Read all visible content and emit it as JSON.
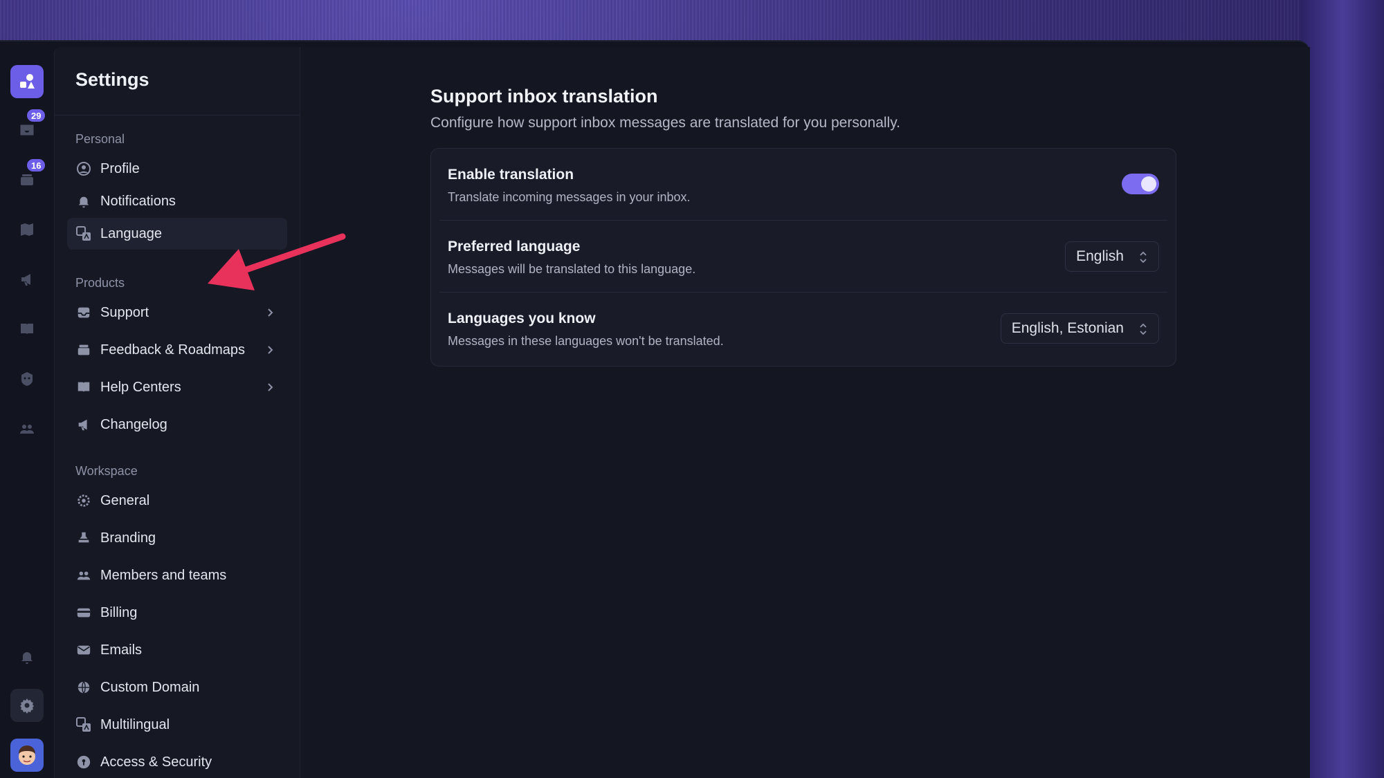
{
  "rail": {
    "items": [
      {
        "icon": "inbox-icon",
        "badge": "29"
      },
      {
        "icon": "archive-icon",
        "badge": "16"
      },
      {
        "icon": "map-icon"
      },
      {
        "icon": "megaphone-icon"
      },
      {
        "icon": "book-icon"
      },
      {
        "icon": "bot-icon"
      },
      {
        "icon": "team-icon"
      }
    ],
    "bottom": [
      {
        "icon": "bell-icon"
      },
      {
        "icon": "gear-icon"
      },
      {
        "icon": "avatar"
      }
    ]
  },
  "sidebar": {
    "title": "Settings",
    "personal_label": "Personal",
    "personal": [
      {
        "label": "Profile",
        "icon": "user-circle-icon"
      },
      {
        "label": "Notifications",
        "icon": "bell-icon"
      },
      {
        "label": "Language",
        "icon": "translate-icon",
        "active": true
      }
    ],
    "products_label": "Products",
    "products": [
      {
        "label": "Support",
        "icon": "inbox-icon"
      },
      {
        "label": "Feedback & Roadmaps",
        "icon": "archive-icon"
      },
      {
        "label": "Help Centers",
        "icon": "book-icon"
      },
      {
        "label": "Changelog",
        "icon": "megaphone-icon"
      }
    ],
    "workspace_label": "Workspace",
    "workspace": [
      {
        "label": "General",
        "icon": "gear-icon"
      },
      {
        "label": "Branding",
        "icon": "stamp-icon"
      },
      {
        "label": "Members and teams",
        "icon": "team-icon"
      },
      {
        "label": "Billing",
        "icon": "card-icon"
      },
      {
        "label": "Emails",
        "icon": "mail-icon"
      },
      {
        "label": "Custom Domain",
        "icon": "globe-icon"
      },
      {
        "label": "Multilingual",
        "icon": "translate-icon"
      },
      {
        "label": "Access & Security",
        "icon": "lock-icon"
      }
    ]
  },
  "main": {
    "title": "Support inbox translation",
    "subtitle": "Configure how support inbox messages are translated for you personally.",
    "rows": [
      {
        "title": "Enable translation",
        "desc": "Translate incoming messages in your inbox.",
        "toggle_on": true
      },
      {
        "title": "Preferred language",
        "desc": "Messages will be translated to this language.",
        "value": "English"
      },
      {
        "title": "Languages you know",
        "desc": "Messages in these languages won't be translated.",
        "value": "English, Estonian"
      }
    ]
  },
  "colors": {
    "accent": "#6d5ee8",
    "annotation_arrow": "#e8315b"
  }
}
